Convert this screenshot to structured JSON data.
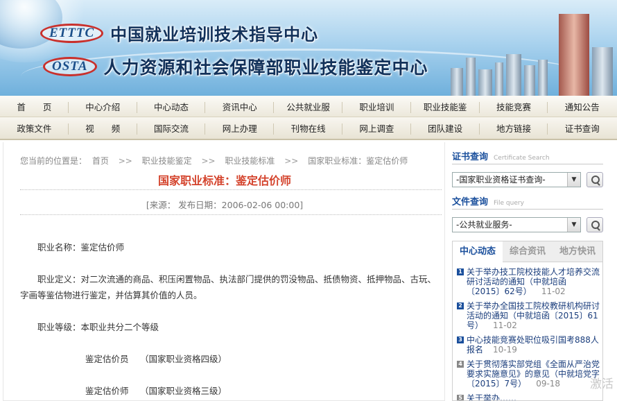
{
  "banner": {
    "logo1": "ETTTC",
    "title1": "中国就业培训技术指导中心",
    "logo2": "OSTA",
    "title2": "人力资源和社会保障部职业技能鉴定中心"
  },
  "nav": {
    "row1": [
      "首　　页",
      "中心介绍",
      "中心动态",
      "资讯中心",
      "公共就业服",
      "职业培训",
      "职业技能鉴",
      "技能竞赛",
      "通知公告"
    ],
    "row2": [
      "政策文件",
      "视　　频",
      "国际交流",
      "网上办理",
      "刊物在线",
      "网上调查",
      "团队建设",
      "地方链接",
      "证书查询"
    ]
  },
  "breadcrumb": {
    "prefix": "您当前的位置是：",
    "items": [
      "首页",
      "职业技能鉴定",
      "职业技能标准",
      "国家职业标准：鉴定估价师"
    ],
    "separator": ">>"
  },
  "article": {
    "title": "国家职业标准：鉴定估价师",
    "meta": "[来源：    发布日期：2006-02-06 00:00]",
    "paragraphs": [
      "职业名称：鉴定估价师",
      "职业定义：对二次流通的商品、积压闲置物品、执法部门提供的罚没物品、抵债物资、抵押物品、古玩、字画等鉴估物进行鉴定，并估算其价值的人员。",
      "职业等级：本职业共分二个等级"
    ],
    "levels": [
      "鉴定估价员　 （国家职业资格四级）",
      "鉴定估价师　 （国家职业资格三级）"
    ]
  },
  "sidebar": {
    "cert": {
      "title": "证书查询",
      "subtitle": "Certificate Search",
      "select": "-国家职业资格证书查询-"
    },
    "file": {
      "title": "文件查询",
      "subtitle": "File query",
      "select": "-公共就业服务-"
    },
    "tabs": [
      "中心动态",
      "综合资讯",
      "地方快讯"
    ],
    "news": [
      {
        "num": "1",
        "text": "关于举办技工院校技能人才培养交流研讨活动的通知（中就培函〔2015〕62号）",
        "date": "11-02"
      },
      {
        "num": "2",
        "text": "关于举办全国技工院校教研机构研讨活动的通知（中就培函〔2015〕61号）",
        "date": "11-02"
      },
      {
        "num": "3",
        "text": "中心技能竞赛处职位吸引国考888人报名",
        "date": "10-19"
      },
      {
        "num": "4",
        "text": "关于贯彻落实部党组《全面从严治党要求实施意见》的意见（中就培党字〔2015〕7号）",
        "date": "09-18"
      },
      {
        "num": "5",
        "text": "关于举办……",
        "date": ""
      }
    ]
  },
  "watermark": "激活"
}
